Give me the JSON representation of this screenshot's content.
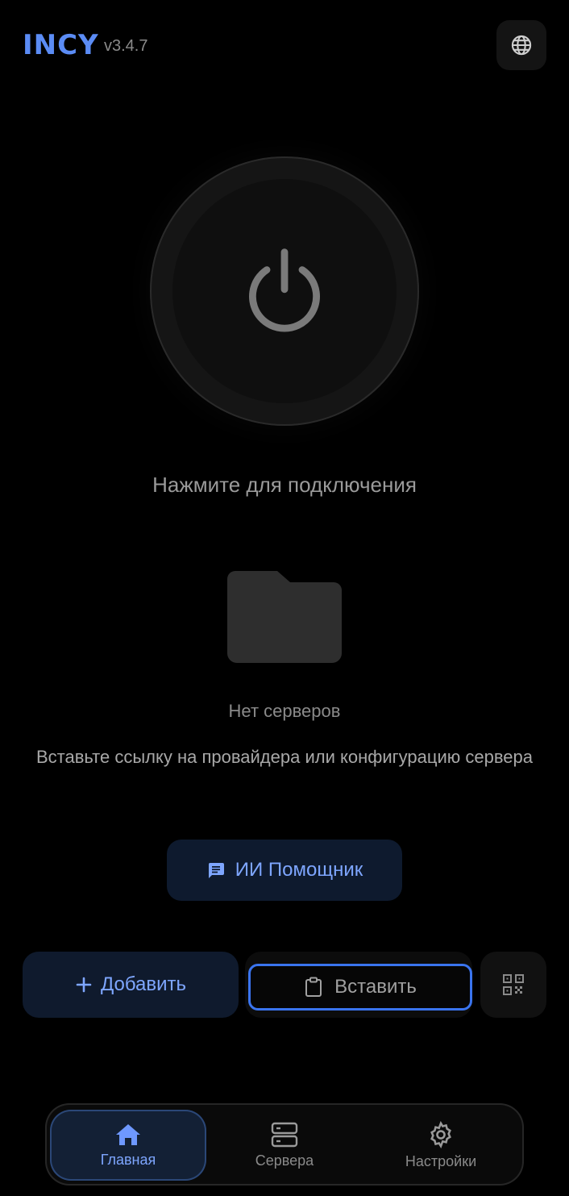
{
  "app": {
    "name": "INCY",
    "version": "v3.4.7"
  },
  "power": {
    "status_text": "Нажмите для подключения"
  },
  "empty_state": {
    "title": "Нет серверов",
    "hint": "Вставьте ссылку на провайдера или конфигурацию сервера"
  },
  "actions": {
    "ai_label": "ИИ Помощник",
    "add_label": "Добавить",
    "paste_label": "Вставить"
  },
  "nav": {
    "items": [
      {
        "label": "Главная",
        "icon": "home-icon",
        "active": true
      },
      {
        "label": "Сервера",
        "icon": "servers-icon",
        "active": false
      },
      {
        "label": "Настройки",
        "icon": "gear-icon",
        "active": false
      }
    ]
  },
  "colors": {
    "accent": "#5b8cf5",
    "accent_light": "#7ea6ff",
    "focus_border": "#3a74ee",
    "background": "#000000"
  }
}
